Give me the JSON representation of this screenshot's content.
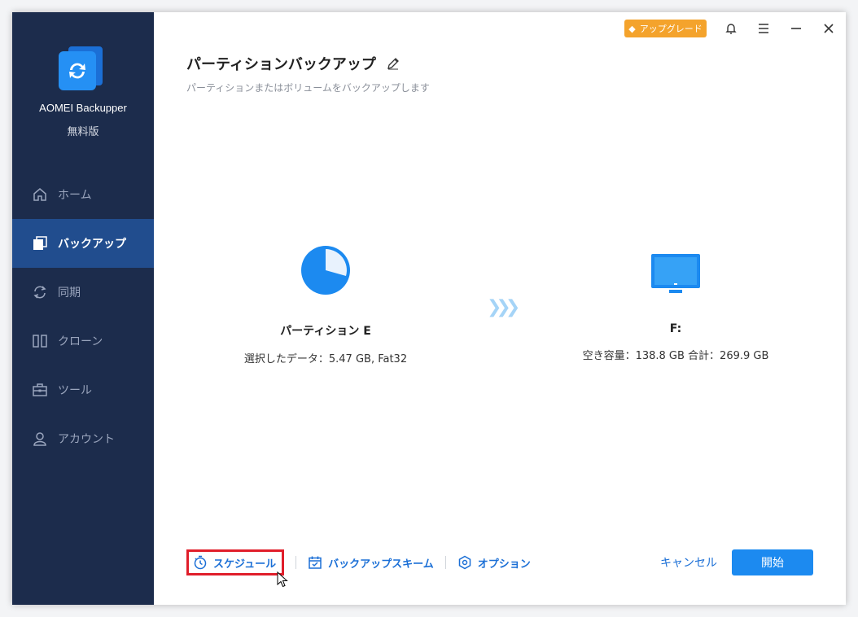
{
  "app": {
    "name": "AOMEI Backupper",
    "edition": "無料版"
  },
  "sidebar": {
    "items": [
      {
        "label": "ホーム",
        "icon": "home-icon",
        "active": false
      },
      {
        "label": "バックアップ",
        "icon": "backup-icon",
        "active": true
      },
      {
        "label": "同期",
        "icon": "sync-icon",
        "active": false
      },
      {
        "label": "クローン",
        "icon": "clone-icon",
        "active": false
      },
      {
        "label": "ツール",
        "icon": "tools-icon",
        "active": false
      },
      {
        "label": "アカウント",
        "icon": "account-icon",
        "active": false
      }
    ]
  },
  "topbar": {
    "upgrade_label": "アップグレード"
  },
  "header": {
    "title": "パーティションバックアップ",
    "subtitle": "パーティションまたはボリュームをバックアップします"
  },
  "source": {
    "name": "パーティション E",
    "detail": "選択したデータ：5.47 GB, Fat32"
  },
  "destination": {
    "name": "F:",
    "detail": "空き容量：138.8 GB 合計：269.9 GB"
  },
  "bottom": {
    "schedule_label": "スケジュール",
    "scheme_label": "バックアップスキーム",
    "options_label": "オプション",
    "cancel_label": "キャンセル",
    "start_label": "開始"
  },
  "colors": {
    "sidebar": "#1c2c4c",
    "accent": "#1c8af0",
    "upgrade": "#f4a32c",
    "highlight": "#e01e2a"
  }
}
